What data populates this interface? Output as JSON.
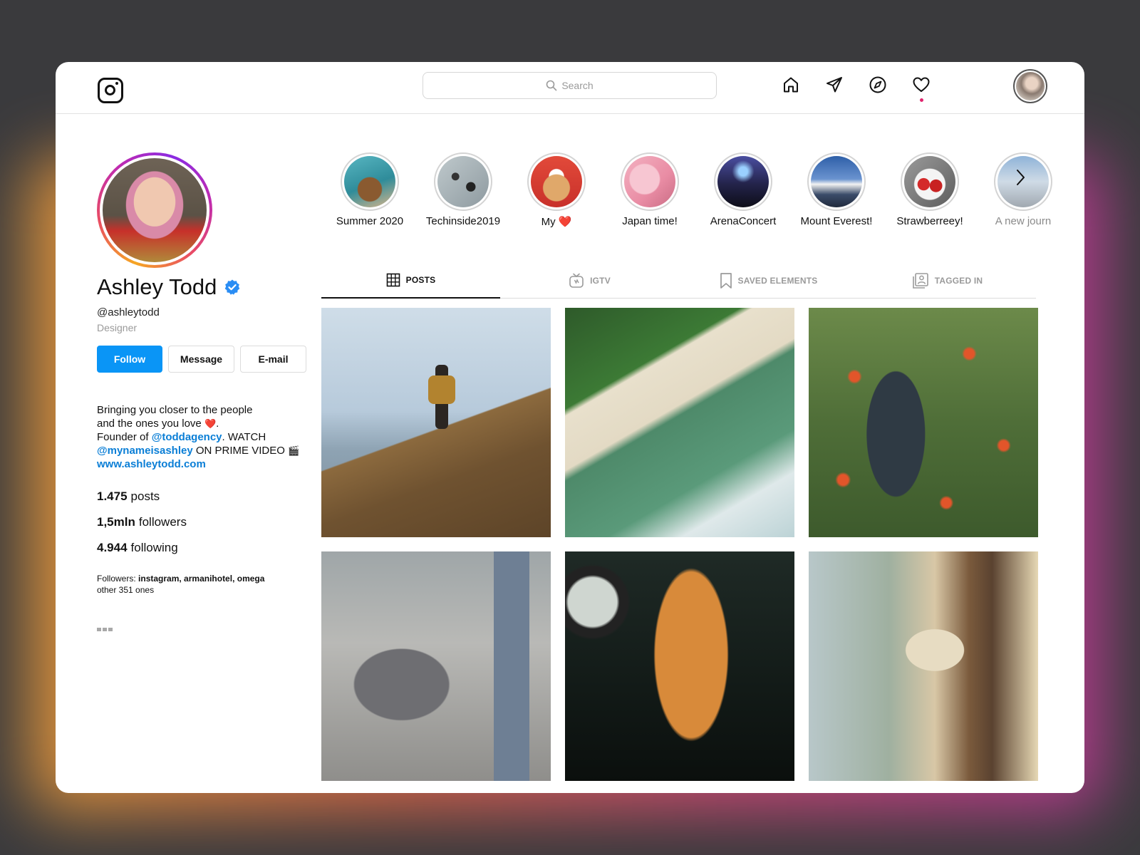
{
  "header": {
    "logo_icon": "instagram-logo-icon",
    "search_placeholder": "Search",
    "nav_icons": [
      "home-icon",
      "direct-message-icon",
      "explore-icon",
      "activity-heart-icon"
    ],
    "notification_color": "#e0246e"
  },
  "profile": {
    "name": "Ashley Todd",
    "handle": "@ashleytodd",
    "role": "Designer",
    "verified_color": "#2a8df4",
    "buttons": {
      "follow": "Follow",
      "message": "Message",
      "email": "E-mail"
    },
    "bio": {
      "line1": "Bringing you closer to the people",
      "line2a": "and the ones you love",
      "heart": "❤️",
      "line2b": ".",
      "line3a": "Founder of",
      "link1": "@toddagency",
      "line3b": ". WATCH",
      "link2": "@mynameisashley",
      "line4": "ON PRIME VIDEO",
      "clapper": "🎬",
      "website": "www.ashleytodd.com"
    },
    "stats": {
      "posts_value": "1.475",
      "posts_label": "posts",
      "followers_value": "1,5mln",
      "followers_label": "followers",
      "following_value": "4.944",
      "following_label": "following"
    },
    "followed_by": {
      "prefix": "Followers:",
      "names": "instagram, armanihotel, omega",
      "others": "other 351 ones"
    }
  },
  "stories": [
    {
      "label": "Summer 2020"
    },
    {
      "label": "Techinside2019"
    },
    {
      "label": "My ❤️"
    },
    {
      "label": "Japan time!"
    },
    {
      "label": "ArenaConcert"
    },
    {
      "label": "Mount Everest!"
    },
    {
      "label": "Strawberreey!"
    },
    {
      "label": "A new journ"
    }
  ],
  "tabs": [
    {
      "label": "POSTS",
      "icon": "grid-icon",
      "active": true
    },
    {
      "label": "IGTV",
      "icon": "igtv-icon",
      "active": false
    },
    {
      "label": "SAVED ELEMENTS",
      "icon": "bookmark-icon",
      "active": false
    },
    {
      "label": "TAGGED IN",
      "icon": "tagged-icon",
      "active": false
    }
  ],
  "accent_colors": {
    "follow_button": "#0a95f6",
    "link": "#0a7ed6"
  }
}
